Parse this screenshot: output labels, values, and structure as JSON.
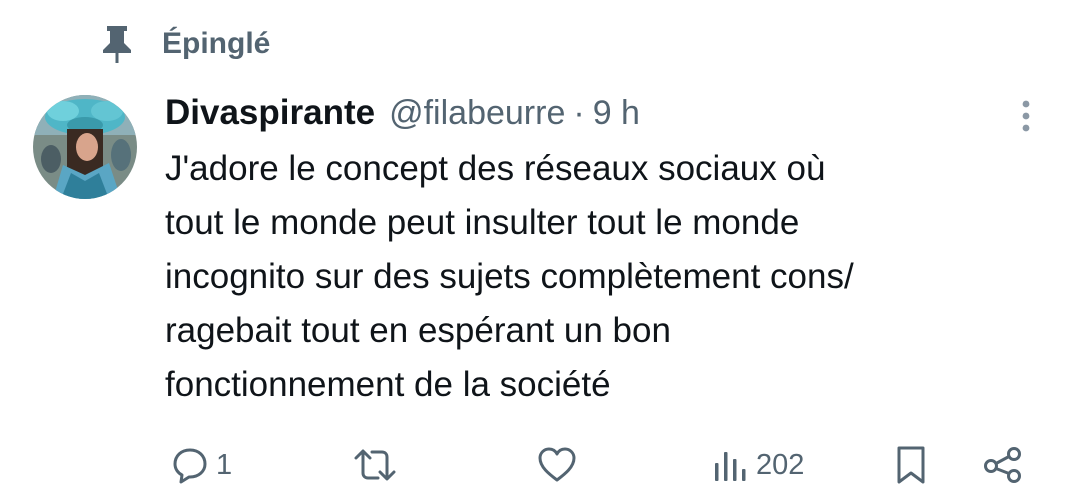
{
  "pinned": {
    "icon": "pin-icon",
    "label": "Épinglé"
  },
  "tweet": {
    "author": {
      "display_name": "Divaspirante",
      "handle": "@filabeurre",
      "avatar_icon": "avatar"
    },
    "separator": "·",
    "time": "9 h",
    "text_lines": [
      "J'adore le concept des réseaux sociaux où",
      "tout le monde peut insulter tout le monde",
      "incognito sur des sujets complètement cons/",
      "ragebait tout en espérant un bon",
      "fonctionnement de la société"
    ],
    "actions": {
      "reply": {
        "icon": "reply-icon",
        "count": "1"
      },
      "retweet": {
        "icon": "retweet-icon",
        "count": ""
      },
      "like": {
        "icon": "heart-icon",
        "count": ""
      },
      "views": {
        "icon": "views-icon",
        "count": "202"
      },
      "bookmark": {
        "icon": "bookmark-icon"
      },
      "share": {
        "icon": "share-icon"
      }
    }
  },
  "colors": {
    "text_primary": "#0f1419",
    "text_secondary": "#536471",
    "background": "#ffffff"
  }
}
